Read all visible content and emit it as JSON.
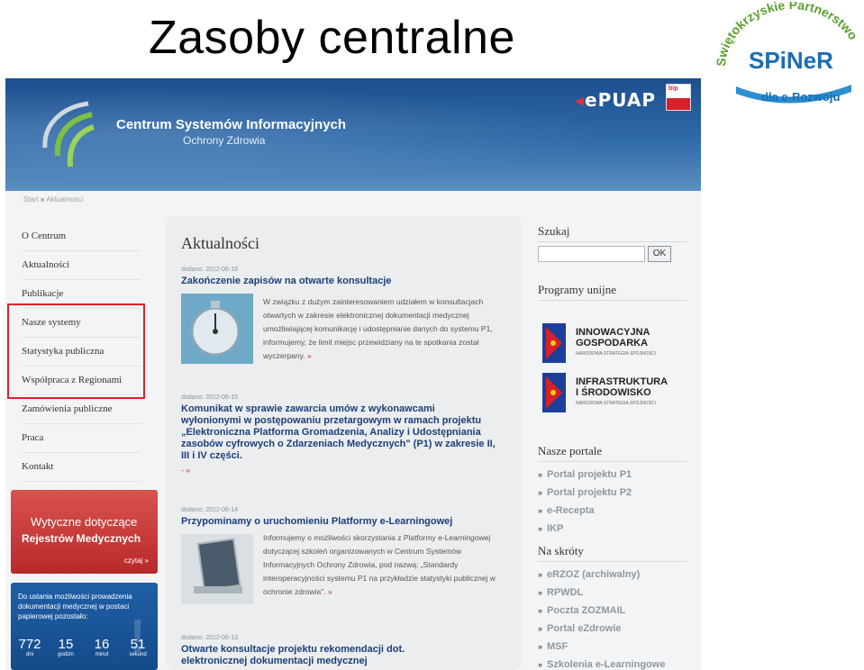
{
  "slide": {
    "title": "Zasoby centralne"
  },
  "spiner": {
    "arc": "Świętokrzyskie Partnerstwo",
    "logo_text": "SPiNeR",
    "subtitle": "dla e-Rozwoju"
  },
  "site": {
    "org_name": "Centrum Systemów Informacyjnych",
    "org_sub": "Ochrony Zdrowia",
    "epuap": "ePUAP",
    "bip": "bip",
    "breadcrumb": [
      "Start",
      "Aktualności"
    ]
  },
  "nav": {
    "items": [
      "O Centrum",
      "Aktualności",
      "Publikacje",
      "Nasze systemy",
      "Statystyka publiczna",
      "Współpraca z Regionami",
      "Zamówienia publiczne",
      "Praca",
      "Kontakt"
    ]
  },
  "banner1": {
    "line1": "Wytyczne dotyczące",
    "line2": "Rejestrów Medycznych",
    "more": "czytaj »"
  },
  "banner2": {
    "text": "Do ustania możliwości prowadzenia dokumentacji medycznej w postaci papierowej pozostało:",
    "countdown": [
      {
        "value": "772",
        "unit": "dni"
      },
      {
        "value": "15",
        "unit": "godzin"
      },
      {
        "value": "16",
        "unit": "minut"
      },
      {
        "value": "51",
        "unit": "sekund"
      }
    ]
  },
  "main": {
    "title": "Aktualności",
    "news": [
      {
        "date": "dodano: 2012-06-18",
        "title": "Zakończenie zapisów na otwarte konsultacje",
        "excerpt": "W związku z dużym zainteresowaniem udziałem w konsultacjach otwartych w zakresie elektronicznej dokumentacji medycznej umożliwiającej komunikację i udostępnianie danych do systemu P1, informujemy, że limit miejsc przewidziany na te spotkania został wyczerpany.",
        "more": "»"
      },
      {
        "date": "dodano: 2012-06-15",
        "title": "Komunikat w sprawie zawarcia umów z wykonawcami wyłonionymi w postępowaniu przetargowym w ramach projektu „Elektroniczna Platforma Gromadzenia, Analizy i Udostępniania zasobów cyfrowych o Zdarzeniach Medycznych\" (P1) w zakresie II, III i IV części.",
        "more": "- »"
      },
      {
        "date": "dodano: 2012-06-14",
        "title": "Przypominamy o uruchomieniu Platformy e-Learningowej",
        "excerpt": "Informujemy o możliwości skorzystania z Platformy e-Learningowej dotyczącej szkoleń organizowanych w Centrum Systemów Informacyjnych Ochrony Zdrowia, pod nazwą: „Standardy interoperacyjności systemu P1 na przykładzie statystyki publicznej w ochronie zdrowia\".",
        "more": "»"
      },
      {
        "date": "dodano: 2012-06-13",
        "title": "Otwarte konsultacje projektu rekomendacji dot. elektronicznej dokumentacji medycznej"
      }
    ]
  },
  "right": {
    "search_heading": "Szukaj",
    "search_button": "OK",
    "programs_heading": "Programy unijne",
    "programs": [
      {
        "name1": "INNOWACYJNA",
        "name2": "GOSPODARKA",
        "sub": "NARODOWA STRATEGIA SPÓJNOŚCI"
      },
      {
        "name1": "INFRASTRUKTURA",
        "name2": "I ŚRODOWISKO",
        "sub": "NARODOWA STRATEGIA SPÓJNOŚCI"
      }
    ],
    "portals_heading": "Nasze portale",
    "portals": [
      "Portal projektu P1",
      "Portal projektu P2",
      "e-Recepta",
      "IKP"
    ],
    "shortcuts_heading": "Na skróty",
    "shortcuts": [
      "eRZOZ (archiwalny)",
      "RPWDL",
      "Poczta ZOZMAIL",
      "Portal eZdrowie",
      "MSF",
      "Szkolenia e-Learningowe"
    ]
  },
  "colors": {
    "header_blue": "#2f6aa9",
    "link_blue": "#1c3f7a",
    "accent_red": "#c8232c",
    "highlight_red": "#e0202a"
  }
}
